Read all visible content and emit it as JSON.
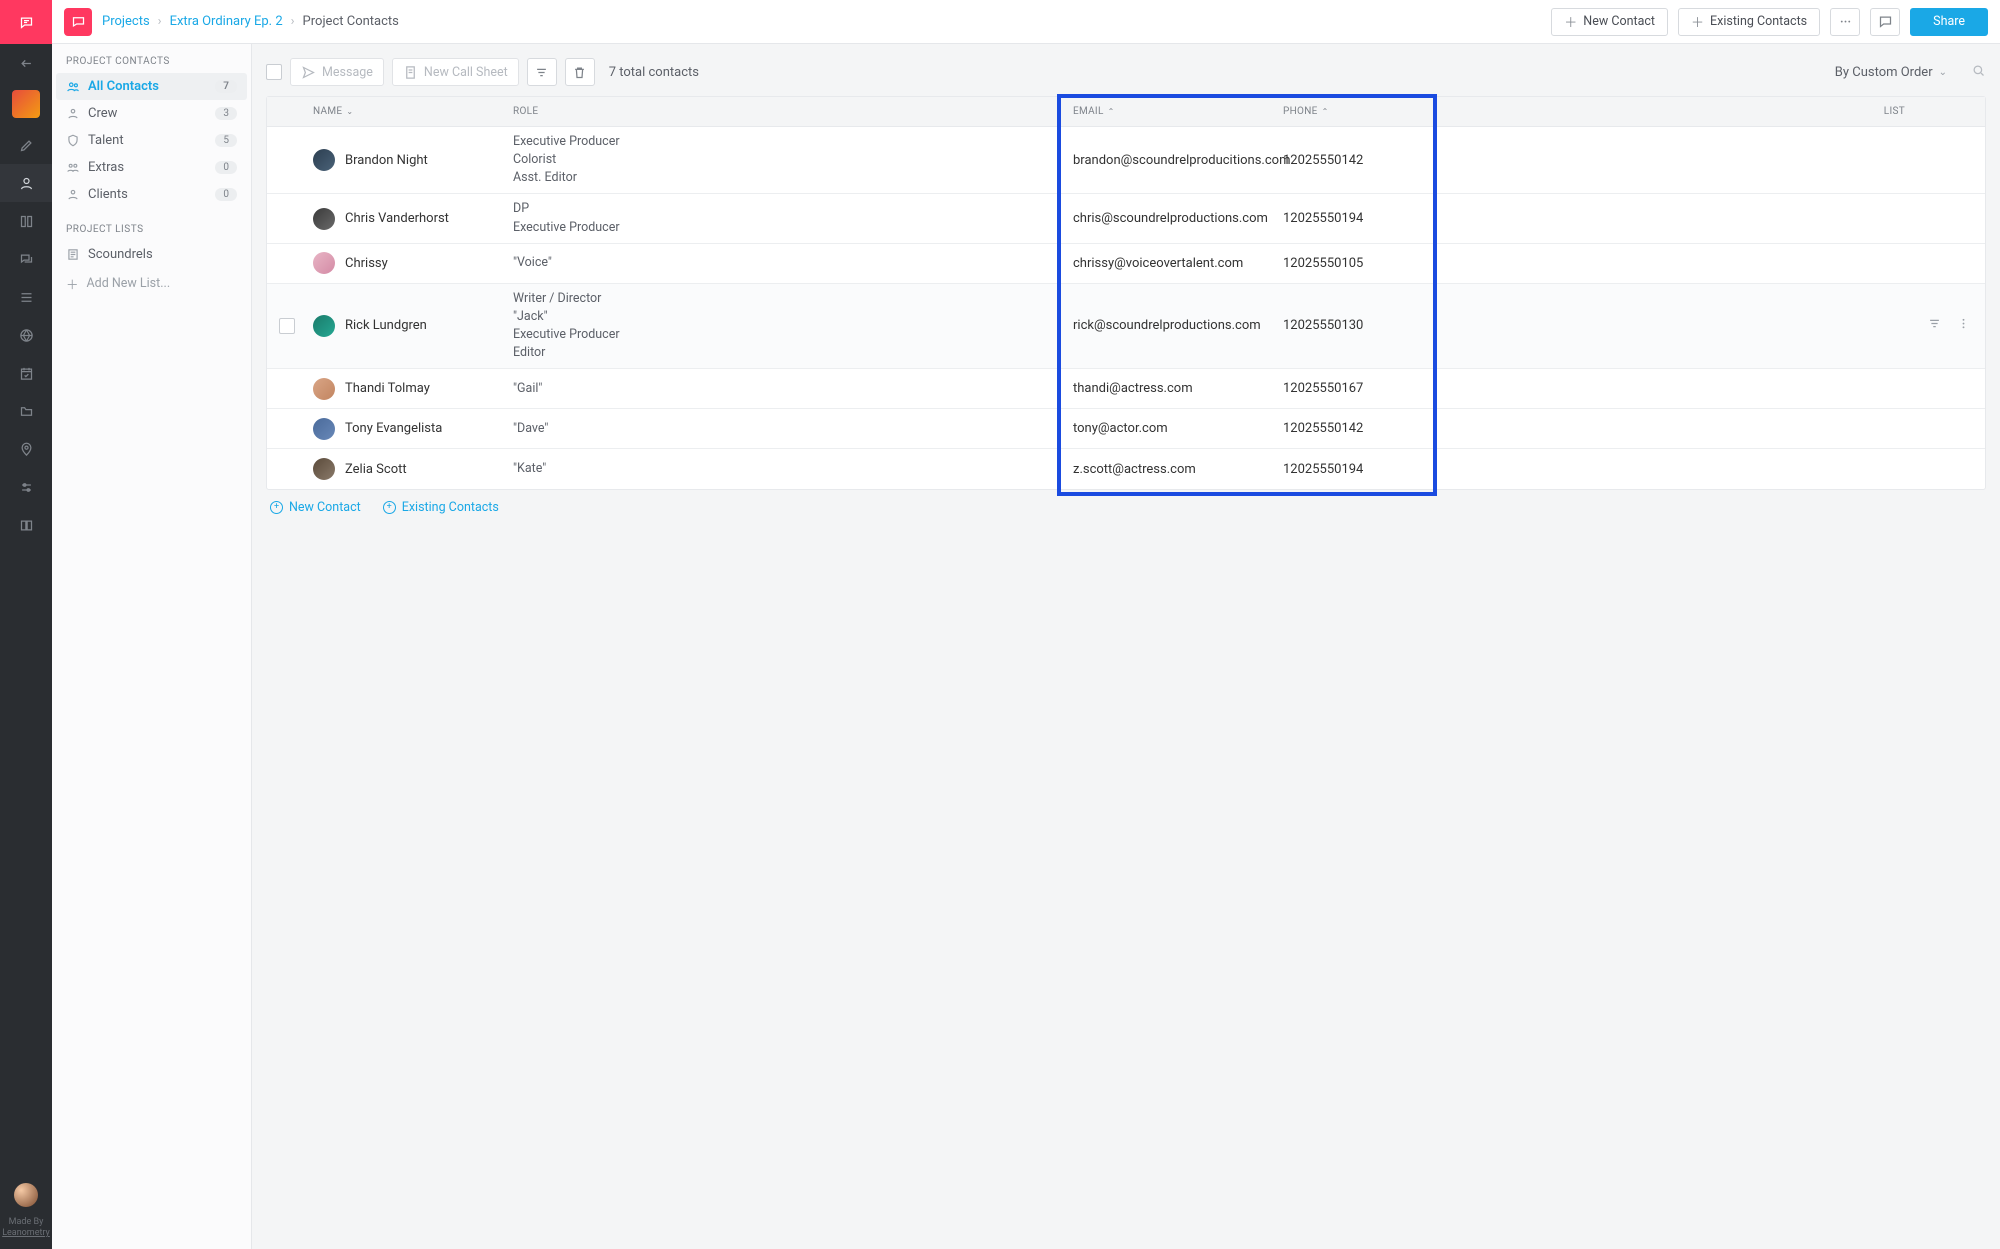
{
  "breadcrumb": {
    "level1": "Projects",
    "level2": "Extra Ordinary Ep. 2",
    "current": "Project Contacts"
  },
  "topbar": {
    "new_contact": "New Contact",
    "existing_contacts": "Existing Contacts",
    "share": "Share"
  },
  "sidebar": {
    "section1_label": "PROJECT CONTACTS",
    "items": [
      {
        "label": "All Contacts",
        "count": "7"
      },
      {
        "label": "Crew",
        "count": "3"
      },
      {
        "label": "Talent",
        "count": "5"
      },
      {
        "label": "Extras",
        "count": "0"
      },
      {
        "label": "Clients",
        "count": "0"
      }
    ],
    "section2_label": "PROJECT LISTS",
    "lists": [
      {
        "label": "Scoundrels"
      }
    ],
    "add_list": "Add New List..."
  },
  "toolbar": {
    "message": "Message",
    "new_call_sheet": "New Call Sheet",
    "total_text": "7 total contacts",
    "sort_label": "By Custom Order"
  },
  "columns": {
    "name": "NAME",
    "role": "ROLE",
    "email": "EMAIL",
    "phone": "PHONE",
    "list": "LIST"
  },
  "rows": [
    {
      "name": "Brandon Night",
      "roles": [
        "Executive Producer",
        "Colorist",
        "Asst. Editor"
      ],
      "email": "brandon@scoundrelproducitions.com",
      "phone": "12025550142"
    },
    {
      "name": "Chris Vanderhorst",
      "roles": [
        "DP",
        "Executive Producer"
      ],
      "email": "chris@scoundrelproductions.com",
      "phone": "12025550194"
    },
    {
      "name": "Chrissy",
      "roles": [
        "\"Voice\""
      ],
      "email": "chrissy@voiceovertalent.com",
      "phone": "12025550105"
    },
    {
      "name": "Rick Lundgren",
      "roles": [
        "Writer / Director",
        "\"Jack\"",
        "Executive Producer",
        "Editor"
      ],
      "email": "rick@scoundrelproductions.com",
      "phone": "12025550130",
      "hovered": true
    },
    {
      "name": "Thandi Tolmay",
      "roles": [
        "\"Gail\""
      ],
      "email": "thandi@actress.com",
      "phone": "12025550167"
    },
    {
      "name": "Tony Evangelista",
      "roles": [
        "\"Dave\""
      ],
      "email": "tony@actor.com",
      "phone": "12025550142"
    },
    {
      "name": "Zelia Scott",
      "roles": [
        "\"Kate\""
      ],
      "email": "z.scott@actress.com",
      "phone": "12025550194"
    }
  ],
  "footer": {
    "new_contact": "New Contact",
    "existing_contacts": "Existing Contacts"
  },
  "rail": {
    "made_by": "Made By",
    "made_by_name": "Leanometry"
  }
}
